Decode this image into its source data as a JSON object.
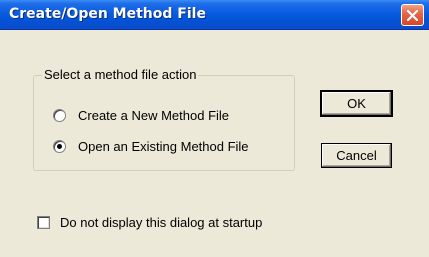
{
  "window": {
    "title": "Create/Open Method File",
    "close_icon": "close-icon"
  },
  "group": {
    "legend": "Select a method file action",
    "options": [
      {
        "label": "Create a New Method File",
        "selected": false
      },
      {
        "label": "Open an Existing Method File",
        "selected": true
      }
    ]
  },
  "buttons": {
    "ok_label": "OK",
    "cancel_label": "Cancel"
  },
  "startup_checkbox": {
    "label": "Do not display this dialog at startup",
    "checked": false
  },
  "colors": {
    "titlebar": "#0a5ce0",
    "dialog_background": "#ece9d8",
    "close_button": "#d9452a"
  }
}
